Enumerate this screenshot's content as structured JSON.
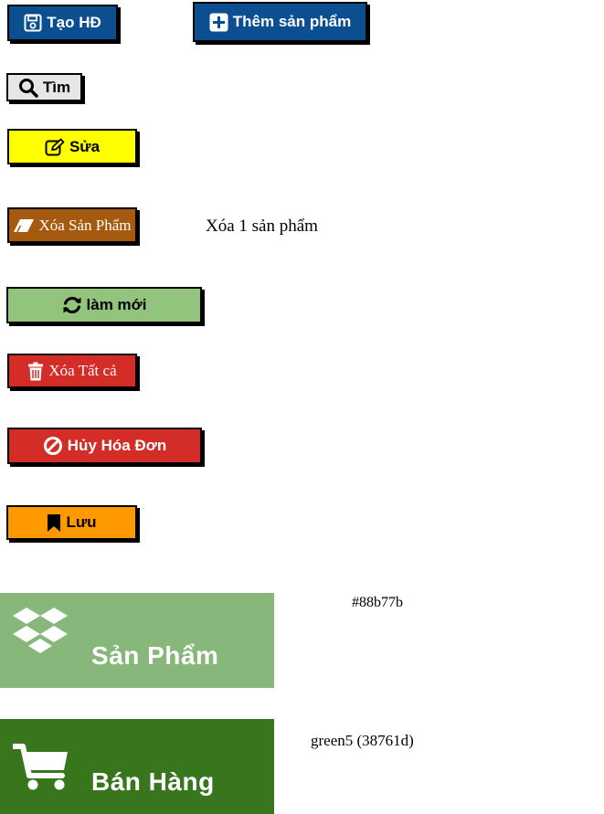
{
  "buttons": {
    "create_invoice": "Tạo HĐ",
    "add_product": "Thêm sản phẩm",
    "search": "Tìm",
    "edit": "Sửa",
    "delete_product": "Xóa Sản Phẩm",
    "refresh": "làm mới",
    "delete_all": "Xóa Tất cả",
    "cancel_invoice": "Hủy Hóa Đơn",
    "save": "Lưu"
  },
  "notes": {
    "delete_one": "Xóa 1 sản phẩm",
    "color_products": "#88b77b",
    "color_sales": "green5 (38761d)"
  },
  "tiles": {
    "products": "Sản Phẩm",
    "sales": "Bán Hàng"
  },
  "colors": {
    "blue": "#0b4f91",
    "yellow": "#ffff00",
    "brown": "#a65a10",
    "light_green": "#93c47d",
    "red": "#d42c27",
    "orange": "#ff9900",
    "gray": "#e6e6e6",
    "tile_products": "#88b77b",
    "tile_sales": "#38761d"
  },
  "icons": {
    "create_invoice": "floppy-disk-icon",
    "add_product": "plus-square-icon",
    "search": "search-icon",
    "edit": "pen-square-icon",
    "delete_product": "eraser-icon",
    "refresh": "refresh-icon",
    "delete_all": "trash-icon",
    "cancel_invoice": "ban-icon",
    "save": "bookmark-icon",
    "products_tile": "dropbox-icon",
    "sales_tile": "shopping-cart-icon"
  }
}
